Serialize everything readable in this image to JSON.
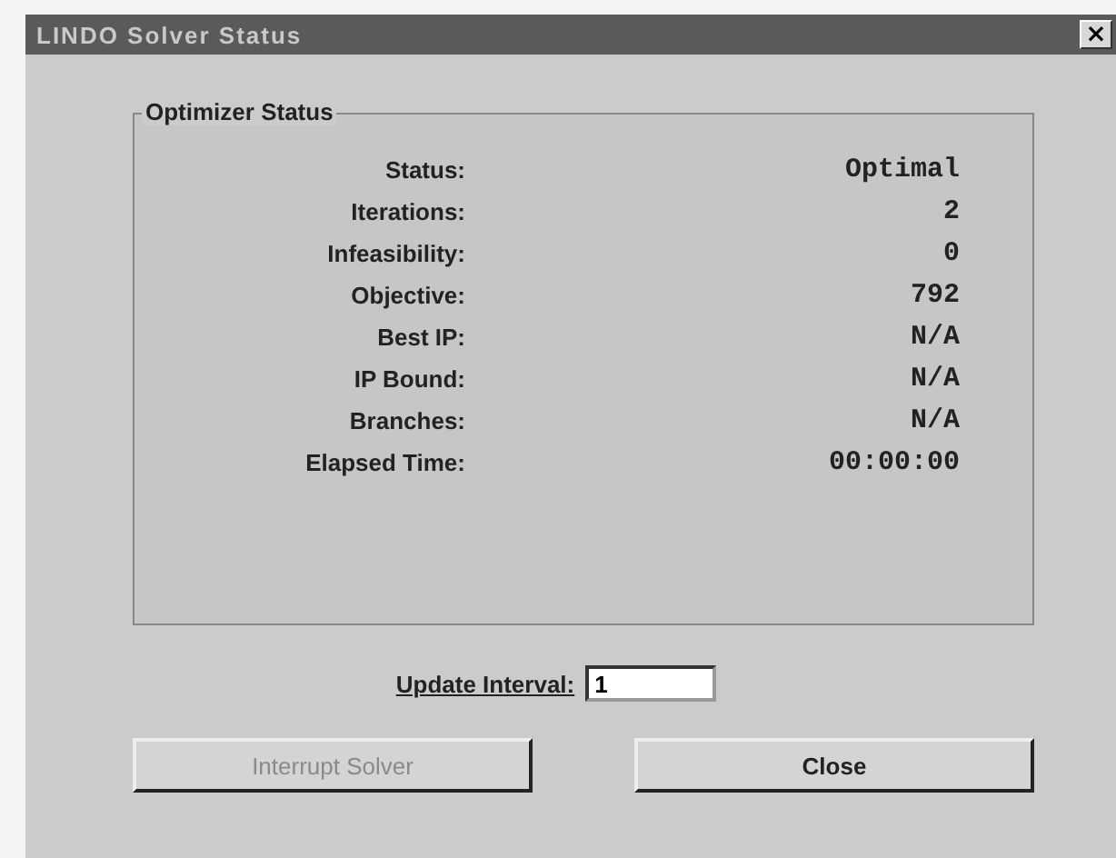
{
  "window": {
    "title": "LINDO Solver Status",
    "close_glyph": "×"
  },
  "group": {
    "title": "Optimizer Status",
    "rows": [
      {
        "label": "Status:",
        "value": "Optimal"
      },
      {
        "label": "Iterations:",
        "value": "2"
      },
      {
        "label": "Infeasibility:",
        "value": "0"
      },
      {
        "label": "Objective:",
        "value": "792"
      },
      {
        "label": "Best IP:",
        "value": "N/A"
      },
      {
        "label": "IP Bound:",
        "value": "N/A"
      },
      {
        "label": "Branches:",
        "value": "N/A"
      },
      {
        "label": "Elapsed Time:",
        "value": "00:00:00"
      }
    ]
  },
  "update_interval": {
    "label": "Update Interval:",
    "value": "1"
  },
  "buttons": [
    {
      "label": "Interrupt Solver",
      "disabled": true
    },
    {
      "label": "Close",
      "disabled": false
    }
  ]
}
